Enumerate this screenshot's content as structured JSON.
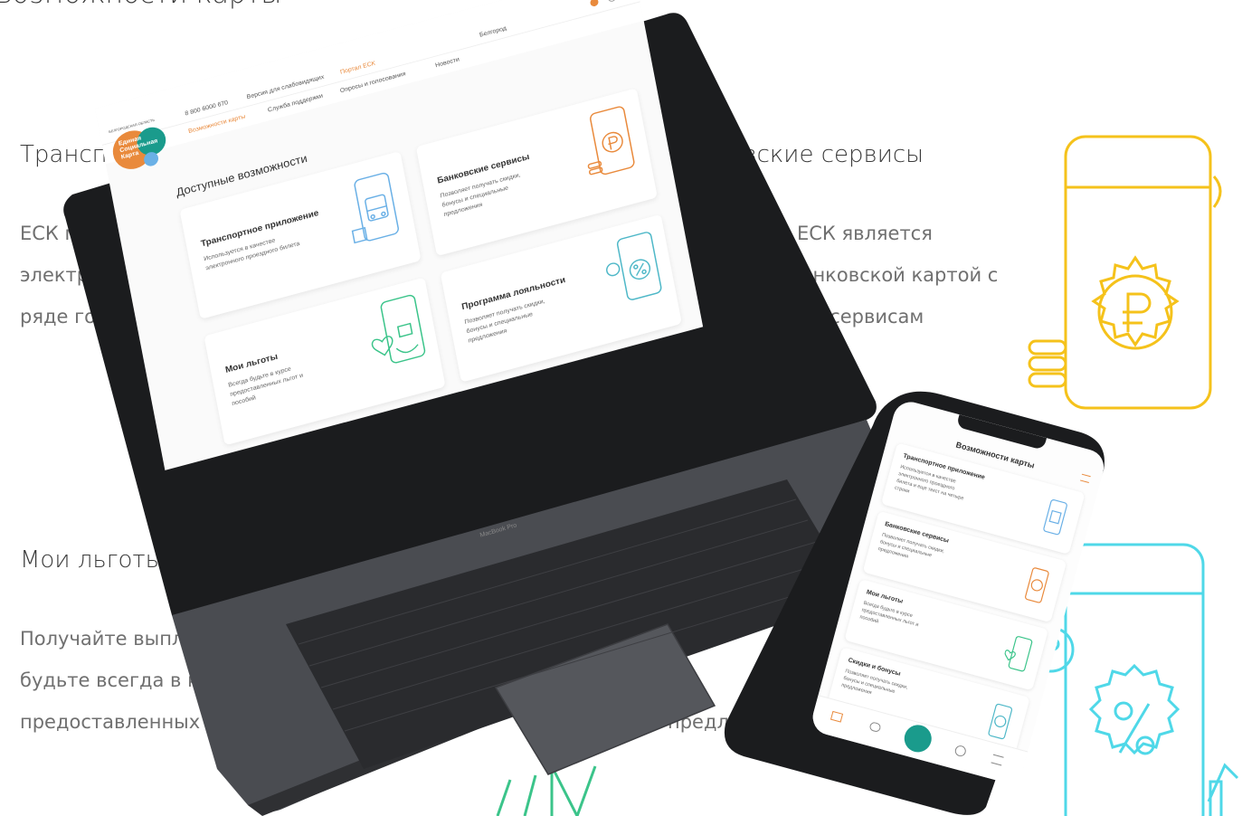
{
  "background": {
    "page_heading": "Возможности карты",
    "sections": [
      {
        "title": "Транспортное п",
        "lines": [
          "ЕСК м",
          "электр",
          "ряде гор"
        ]
      },
      {
        "title": "ковские сервисы",
        "lines": [
          "совая ЕСК является",
          "нной банковской картой с",
          "ельными сервисам"
        ]
      },
      {
        "title": "Мои льготы",
        "lines": [
          "Получайте выплат",
          "будьте всегда в курсе",
          "предоставленных Вам льгот"
        ]
      },
      {
        "title": "",
        "lines": [
          "предл"
        ]
      }
    ]
  },
  "laptop": {
    "brand": "MacBook Pro",
    "topbar": {
      "phone": "8 800 6000 670",
      "accessibility": "Версия для слабовидящих",
      "portal": "Портал ЕСК",
      "location": "Белгород"
    },
    "logo": {
      "region": "БЕЛГОРОДСКАЯ ОБЛАСТЬ",
      "line1": "Единая",
      "line2": "Социальная",
      "line3": "Карта"
    },
    "nav": [
      "Возможности карты",
      "Служба поддержки",
      "Опросы и голосования",
      "Новости"
    ],
    "section_title": "Доступные возможности",
    "cards": [
      {
        "title": "Транспортное приложение",
        "text": "Используется в качестве\nэлектронного проездного билета",
        "icon": "bus-phone-icon"
      },
      {
        "title": "Банковские сервисы",
        "text": "Позволяет получать скидки,\nбонусы и специальные\nпредложения",
        "icon": "ruble-gear-phone-icon"
      },
      {
        "title": "Мои льготы",
        "text": "Всегда будьте в курсе\nпредоставленных льгот и\nпособий",
        "icon": "heart-hand-phone-icon"
      },
      {
        "title": "Программа лояльности",
        "text": "Позволяет получать скидки,\nбонусы и специальные\nпредложения",
        "icon": "percent-phone-icon"
      }
    ]
  },
  "phone": {
    "title": "Возможности карты",
    "cards": [
      {
        "title": "Транспортное приложение",
        "text": "Используется в качестве\nэлектронного проездного\nбилета и еще текст на четыре\nстроки"
      },
      {
        "title": "Банковские сервисы",
        "text": "Позволяет получать скидки,\nбонусы и специальные\nпредложения"
      },
      {
        "title": "Мои льготы",
        "text": "Всегда будьте в курсе\nпредоставленных льгот и\nпособий"
      },
      {
        "title": "Скидки и бонусы",
        "text": "Позволяет получать скидки,\nбонусы и специальные\nпредложения"
      }
    ]
  },
  "colors": {
    "orange": "#e98a3c",
    "yellow": "#f5c21b",
    "cyan": "#4fd8e8",
    "blue": "#6ab0e6",
    "green": "#3bc48a",
    "teal": "#1a9b8c"
  }
}
